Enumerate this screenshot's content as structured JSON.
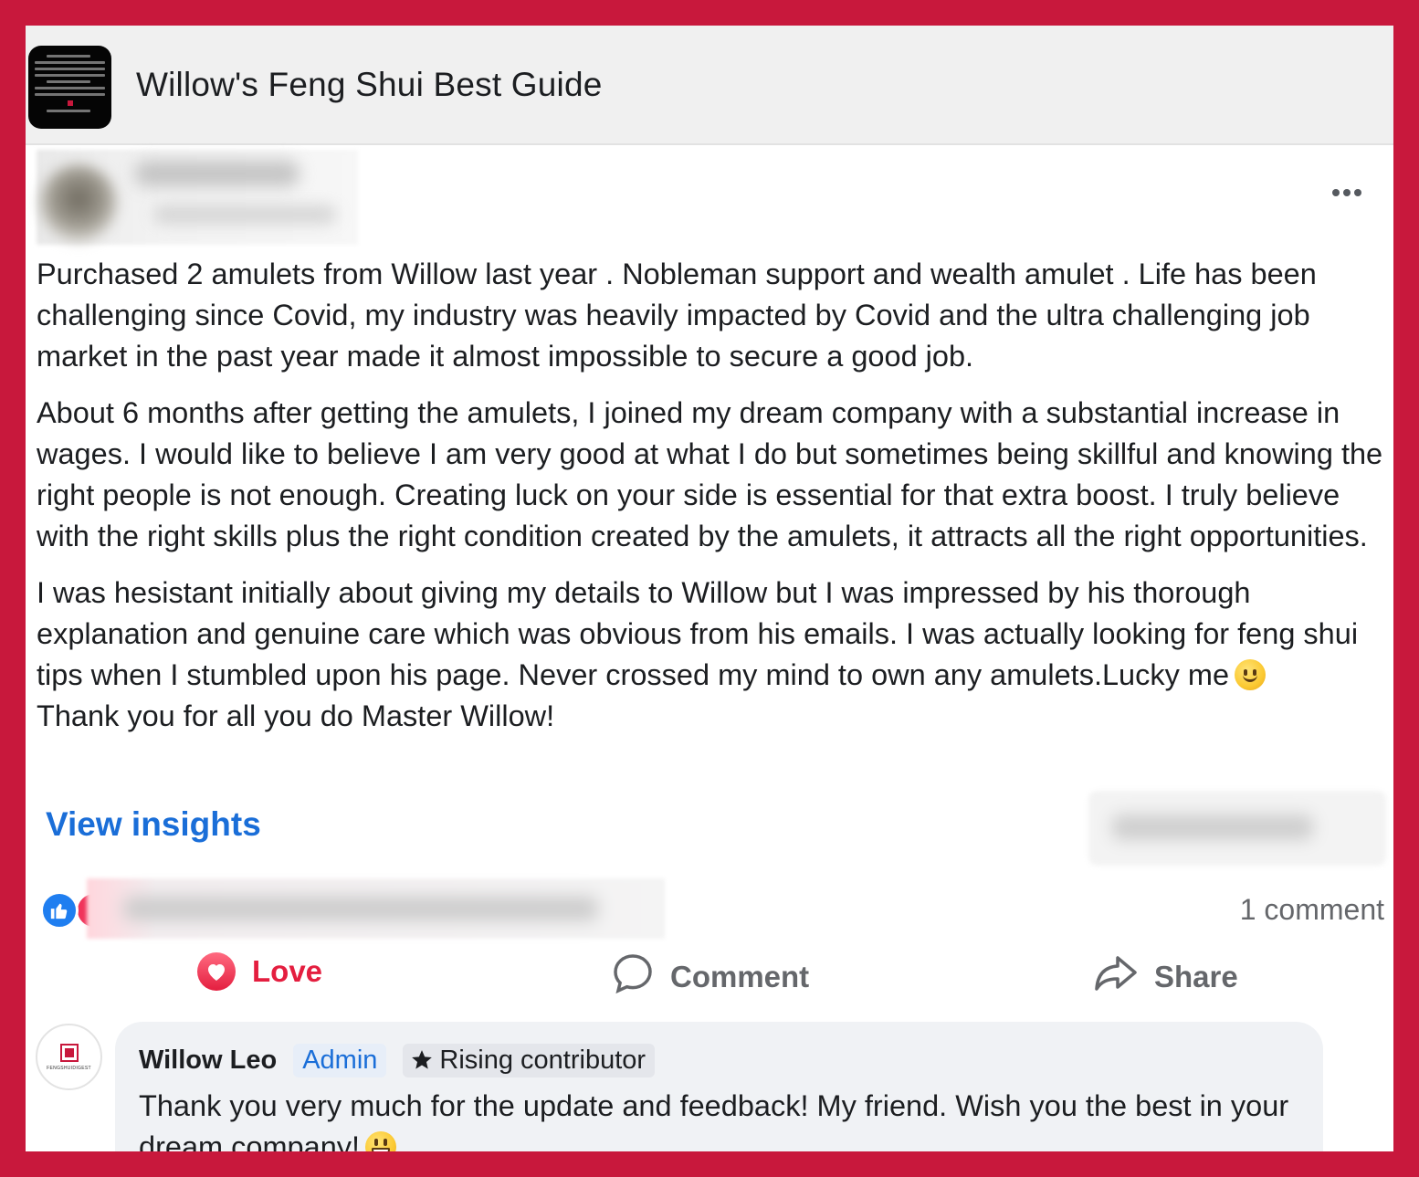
{
  "group": {
    "title": "Willow's Feng Shui Best Guide"
  },
  "post": {
    "paragraphs": [
      "Purchased 2 amulets from Willow last year . Nobleman support and wealth amulet . Life has been challenging since Covid, my industry was heavily impacted by Covid and the ultra challenging job market in the past year made it almost impossible to secure a good job.",
      "About 6 months after getting the amulets, I joined my dream company with a substantial increase in wages. I would like to believe I am very good at what I do but sometimes being skillful and knowing the right people is not enough. Creating luck on your side is essential for that extra boost. I truly believe with the right skills plus the right condition created by the amulets, it attracts all the right opportunities.",
      "I was hesistant initially about giving my details to Willow but I was impressed by his thorough explanation and genuine care which was obvious from his emails. I was actually looking for feng shui tips when I stumbled upon his page. Never crossed my mind to own any amulets.Lucky me",
      "Thank you for all you do Master Willow!"
    ],
    "view_insights": "View insights",
    "comment_count": "1 comment"
  },
  "actions": {
    "love": "Love",
    "comment": "Comment",
    "share": "Share"
  },
  "comment": {
    "author": "Willow Leo",
    "admin_badge": "Admin",
    "contributor_badge": "Rising contributor",
    "text": "Thank you very much for the update and feedback! My friend. Wish you the best in your dream company!",
    "avatar_brand": "FENGSHUIDIGEST"
  },
  "colors": {
    "frame": "#c8183c",
    "link": "#1a6ed8",
    "love": "#e41e3f",
    "muted": "#65676b"
  }
}
